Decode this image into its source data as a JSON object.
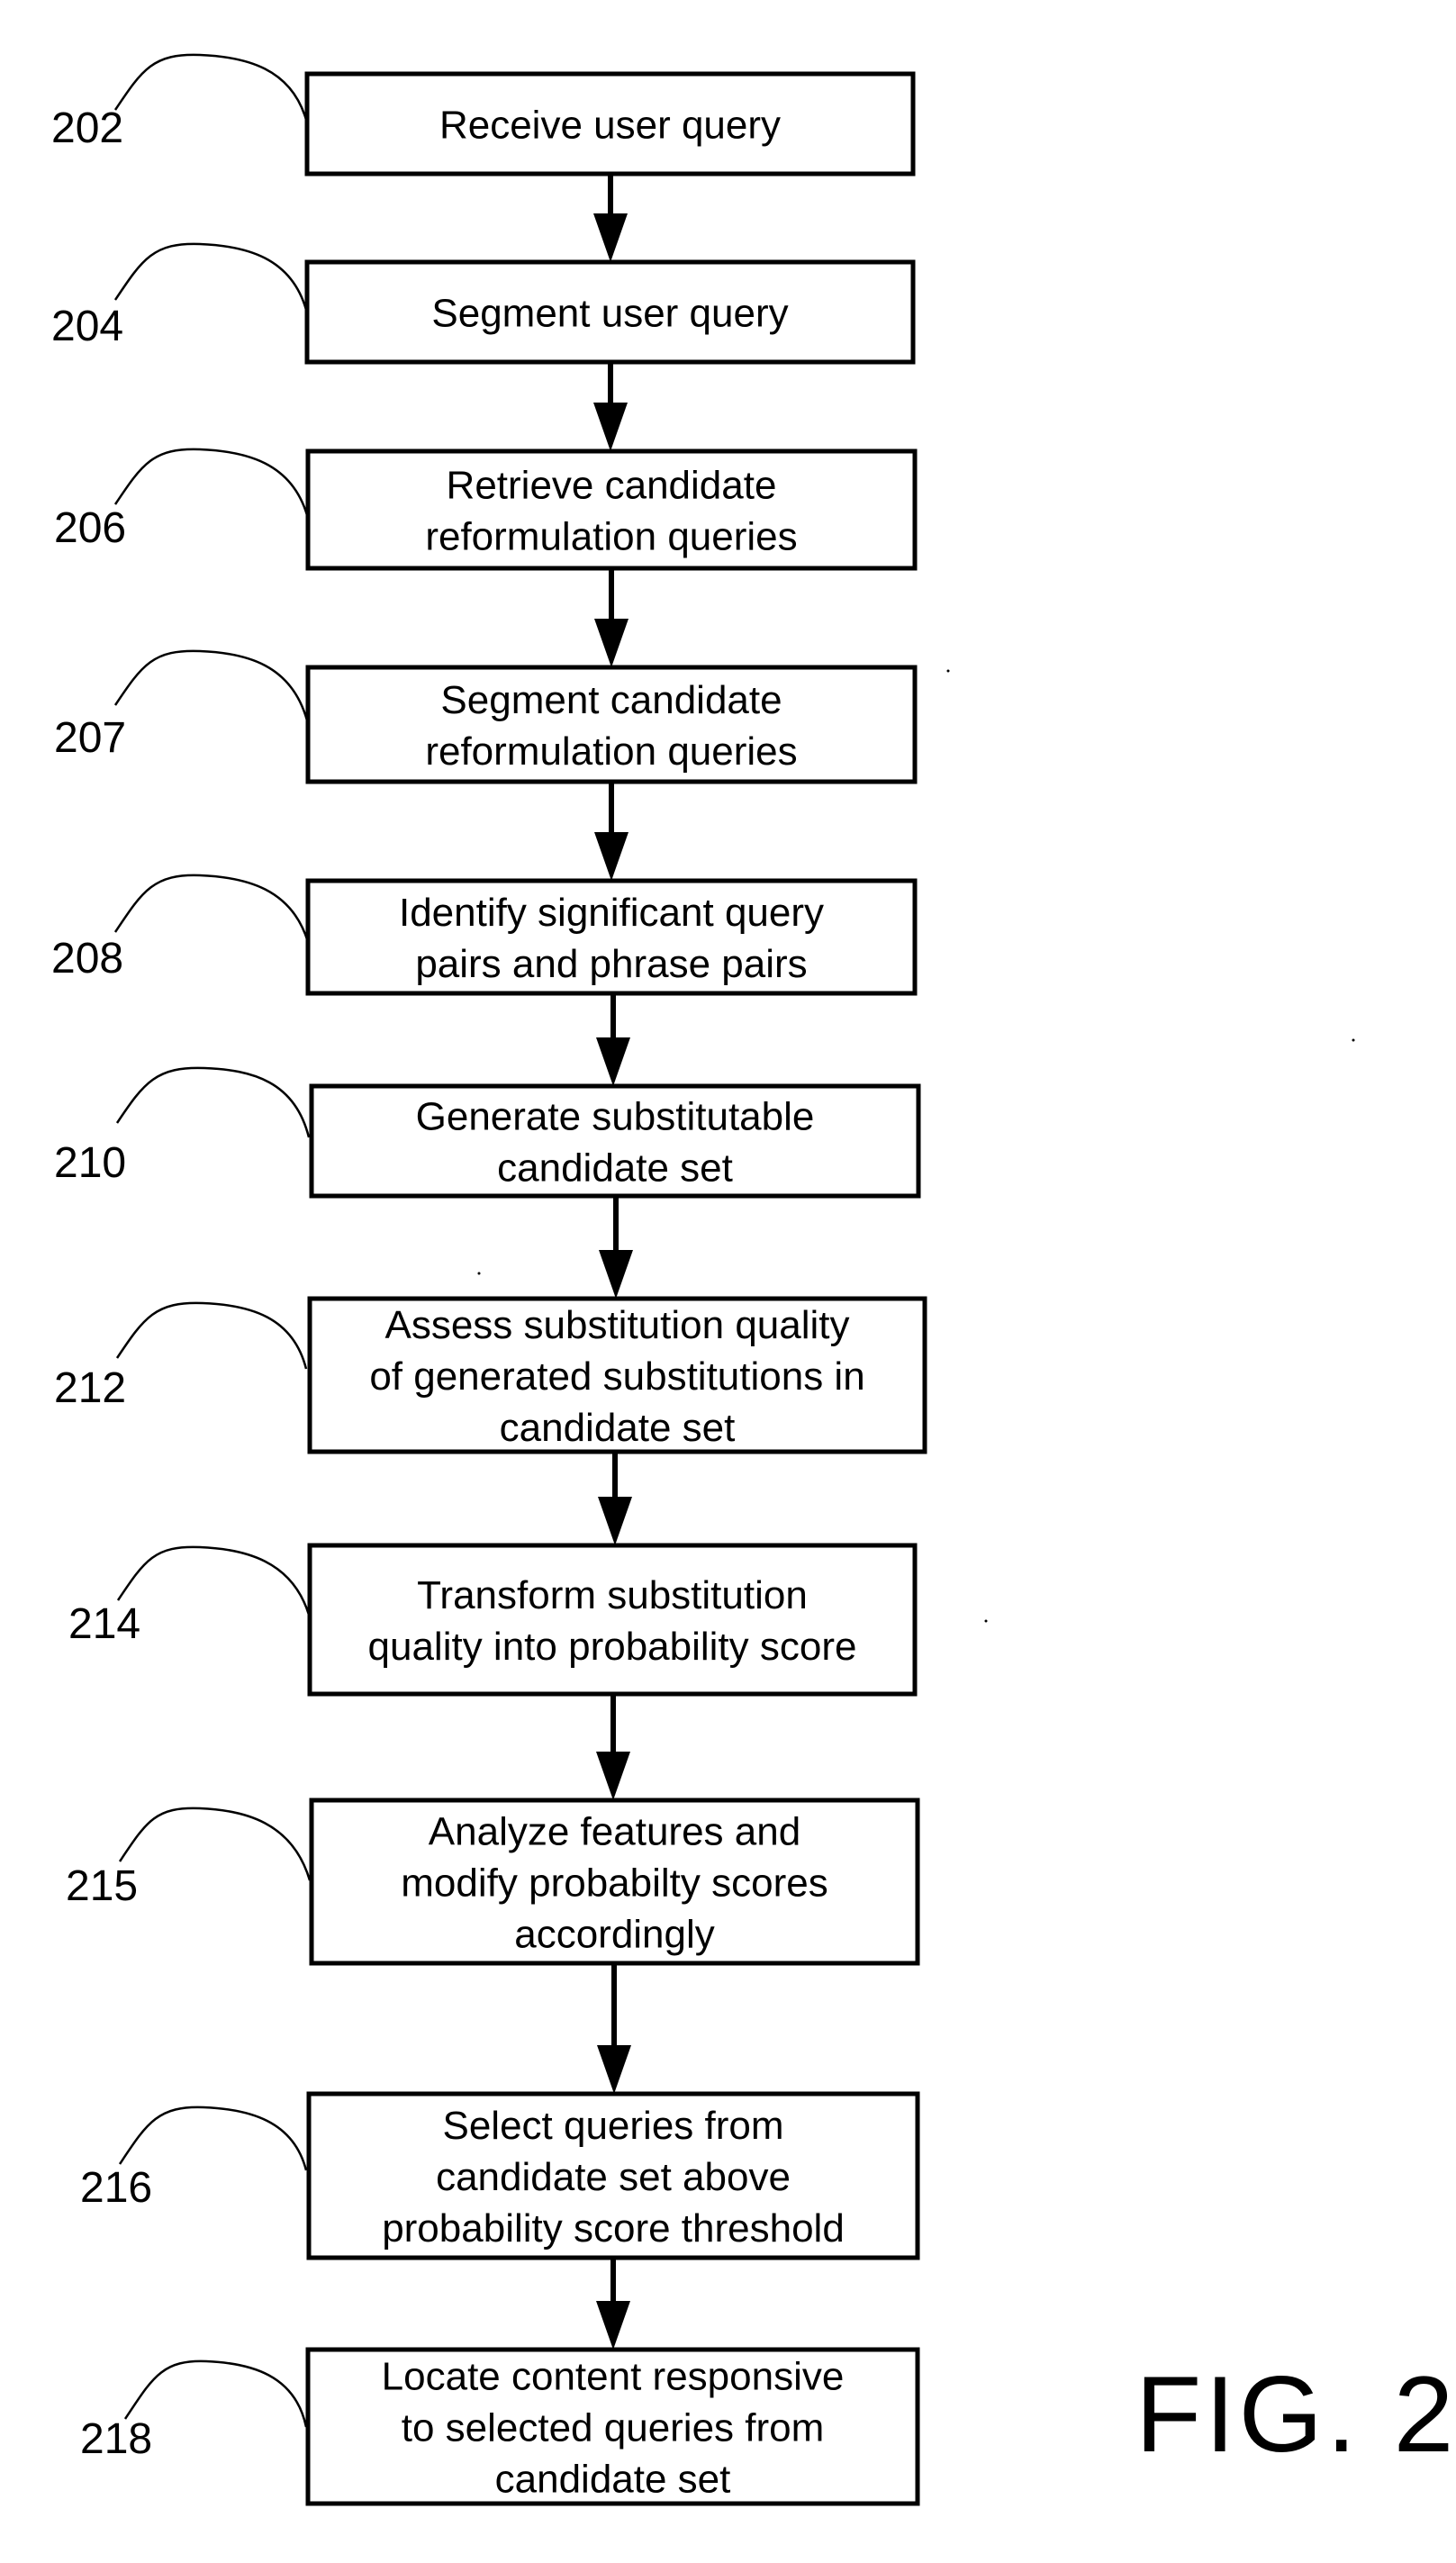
{
  "figure": {
    "title": "FIG. 2",
    "type": "flowchart",
    "direction": "top-to-bottom"
  },
  "steps": [
    {
      "ref": "202",
      "lines": [
        "Receive user query"
      ]
    },
    {
      "ref": "204",
      "lines": [
        "Segment user query"
      ]
    },
    {
      "ref": "206",
      "lines": [
        "Retrieve candidate",
        "reformulation queries"
      ]
    },
    {
      "ref": "207",
      "lines": [
        "Segment candidate",
        "reformulation queries"
      ]
    },
    {
      "ref": "208",
      "lines": [
        "Identify significant query",
        "pairs and phrase pairs"
      ]
    },
    {
      "ref": "210",
      "lines": [
        "Generate substitutable",
        "candidate set"
      ]
    },
    {
      "ref": "212",
      "lines": [
        "Assess substitution quality",
        "of generated substitutions in",
        "candidate set"
      ]
    },
    {
      "ref": "214",
      "lines": [
        "Transform substitution",
        "quality into probability score"
      ]
    },
    {
      "ref": "215",
      "lines": [
        "Analyze features and",
        "modify probabilty scores",
        "accordingly"
      ]
    },
    {
      "ref": "216",
      "lines": [
        "Select queries from",
        "candidate set above",
        "probability score threshold"
      ]
    },
    {
      "ref": "218",
      "lines": [
        "Locate content responsive",
        "to selected queries from",
        "candidate set"
      ]
    }
  ],
  "connections": [
    {
      "from": "202",
      "to": "204"
    },
    {
      "from": "204",
      "to": "206"
    },
    {
      "from": "206",
      "to": "207"
    },
    {
      "from": "207",
      "to": "208"
    },
    {
      "from": "208",
      "to": "210"
    },
    {
      "from": "210",
      "to": "212"
    },
    {
      "from": "212",
      "to": "214"
    },
    {
      "from": "214",
      "to": "215"
    },
    {
      "from": "215",
      "to": "216"
    },
    {
      "from": "216",
      "to": "218"
    }
  ]
}
